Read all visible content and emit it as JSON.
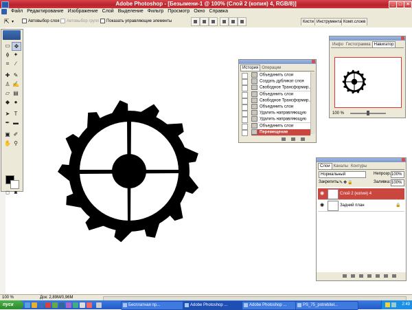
{
  "window": {
    "title": "Adobe Photoshop - [Безымени-1 @ 100% (Слой 2 (копия) 4, RGB/8)]"
  },
  "menu": [
    "Файл",
    "Редактирование",
    "Изображение",
    "Слой",
    "Выделение",
    "Фильтр",
    "Просмотр",
    "Окно",
    "Справка"
  ],
  "options": {
    "autoselect_layer": "Автовыбор слоя",
    "autoselect_group": "Автовыбор групп",
    "show_controls": "Показать управляющие элементы"
  },
  "palette_well": {
    "tabs": [
      "Кисти",
      "Инструмента",
      "Комп.слоев"
    ]
  },
  "history": {
    "tabs": [
      "История",
      "Операции"
    ],
    "items": [
      "Объединить слои",
      "Создать дубликат слоя",
      "Свободное Трансформир...",
      "Объединить слои",
      "Свободное Трансформир...",
      "Объединить слои",
      "Удалить направляющую",
      "Удалить направляющую",
      "Объединить слои",
      "Перемещение"
    ]
  },
  "navigator": {
    "tabs": [
      "Инфо",
      "Гистограмма",
      "Навигатор"
    ],
    "zoom": "100 %"
  },
  "layers": {
    "tabs": [
      "Слои",
      "Каналы",
      "Контуры"
    ],
    "blend_mode": "Нормальный",
    "opacity_label": "Непрозр.:",
    "opacity_value": "100%",
    "lock_label": "Закрепить:",
    "fill_label": "Заливка:",
    "fill_value": "100%",
    "items": [
      {
        "name": "Слой 2 (копия) 4"
      },
      {
        "name": "Задний план"
      }
    ]
  },
  "status": {
    "zoom": "100 %",
    "doc": "Док: 2,89M/0,96M"
  },
  "taskbar": {
    "start": "пуск",
    "tasks": [
      "Бесплатная пр...",
      "Adobe Photoshop ...",
      "Adobe Photoshop ...",
      "PS_75_potrebitel..."
    ],
    "clock": "2:49"
  }
}
